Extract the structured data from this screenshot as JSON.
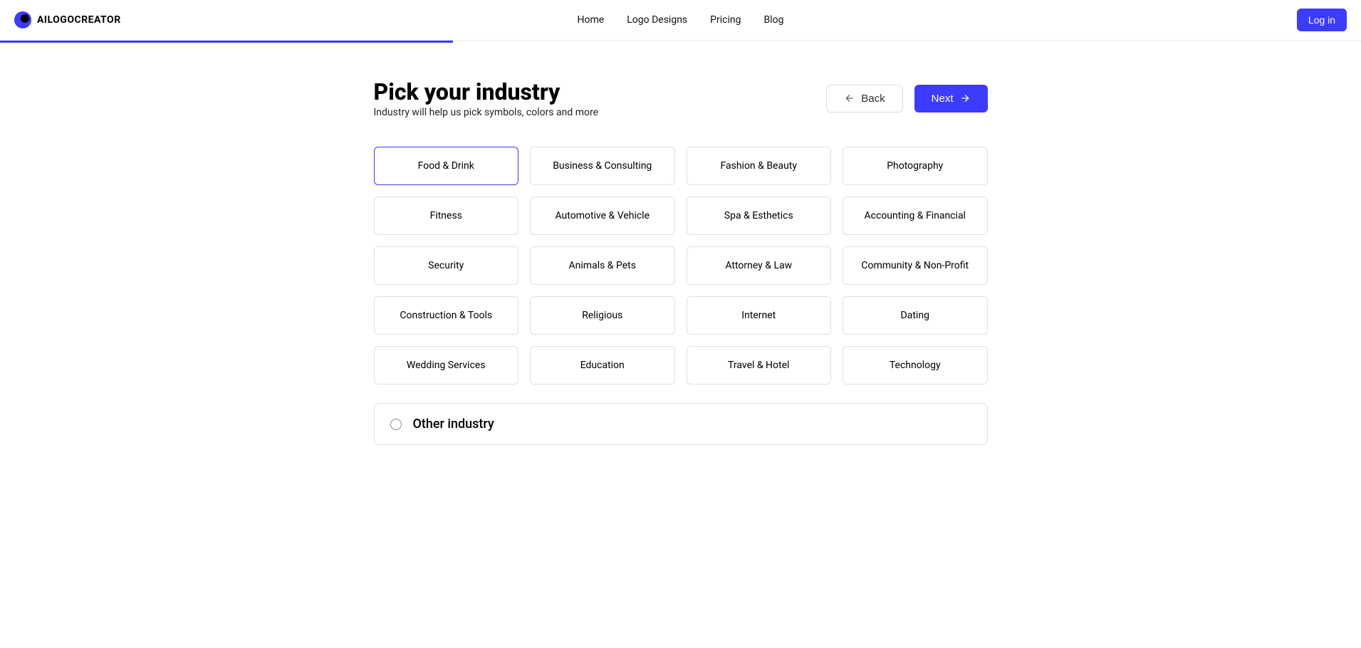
{
  "header": {
    "logo_text": "AILOGOCREATOR",
    "nav": [
      "Home",
      "Logo Designs",
      "Pricing",
      "Blog"
    ],
    "login_label": "Log in"
  },
  "main": {
    "title": "Pick your industry",
    "subtitle": "Industry will help us pick symbols, colors and more",
    "back_label": "Back",
    "next_label": "Next",
    "industries": [
      "Food & Drink",
      "Business & Consulting",
      "Fashion & Beauty",
      "Photography",
      "Fitness",
      "Automotive & Vehicle",
      "Spa & Esthetics",
      "Accounting & Financial",
      "Security",
      "Animals & Pets",
      "Attorney & Law",
      "Community & Non-Profit",
      "Construction & Tools",
      "Religious",
      "Internet",
      "Dating",
      "Wedding Services",
      "Education",
      "Travel & Hotel",
      "Technology"
    ],
    "selected_index": 0,
    "other_label": "Other industry"
  }
}
